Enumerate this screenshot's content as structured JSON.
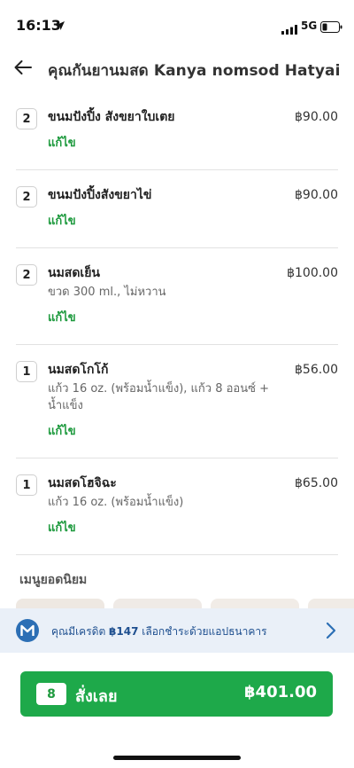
{
  "status_bar": {
    "time": "16:13",
    "network": "5G"
  },
  "header": {
    "title": "คุณกันยานมสด Kanya nomsod Hatyai"
  },
  "items": [
    {
      "qty": "2",
      "name": "ขนมปังปิ้ง สังขยาใบเตย",
      "description": "",
      "edit": "แก้ไข",
      "price": "฿90.00"
    },
    {
      "qty": "2",
      "name": "ขนมปังปิ้งสังขยาไข่",
      "description": "",
      "edit": "แก้ไข",
      "price": "฿90.00"
    },
    {
      "qty": "2",
      "name": "นมสดเย็น",
      "description": "ขวด 300 ml., ไม่หวาน",
      "edit": "แก้ไข",
      "price": "฿100.00"
    },
    {
      "qty": "1",
      "name": "นมสดโกโก้",
      "description": "แก้ว 16 oz. (พร้อมน้ำแข็ง), แก้ว 8 ออนซ์ + น้ำแข็ง",
      "edit": "แก้ไข",
      "price": "฿56.00"
    },
    {
      "qty": "1",
      "name": "นมสดโฮจิฉะ",
      "description": "แก้ว 16 oz. (พร้อมน้ำแข็ง)",
      "edit": "แก้ไข",
      "price": "฿65.00"
    }
  ],
  "popular": {
    "title": "เมนูยอดนิยม"
  },
  "credit_banner": {
    "prefix": "คุณมีเครดิต ",
    "amount": "฿147",
    "suffix": " เลือกชำระด้วยแอปธนาคาร"
  },
  "order_button": {
    "count": "8",
    "label": "สั่งเลย",
    "total": "฿401.00"
  },
  "colors": {
    "accent": "#1ea94a",
    "link": "#1e9a3e",
    "banner": "#eaf0f8",
    "bank_logo": "#2c6fb5"
  }
}
